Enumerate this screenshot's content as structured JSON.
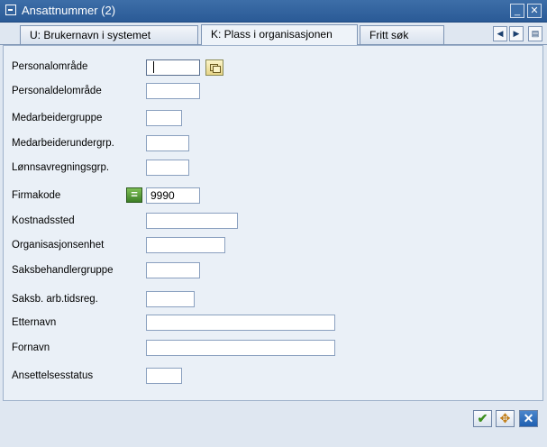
{
  "window": {
    "title": "Ansattnummer (2)"
  },
  "tabs": [
    {
      "label": "U: Brukernavn i systemet"
    },
    {
      "label": "K: Plass i organisasjonen"
    },
    {
      "label": "Fritt søk"
    }
  ],
  "form": {
    "fields": [
      {
        "label": "Personalområde",
        "value": ""
      },
      {
        "label": "Personaldelområde",
        "value": ""
      },
      {
        "label": "Medarbeidergruppe",
        "value": ""
      },
      {
        "label": "Medarbeiderundergrp.",
        "value": ""
      },
      {
        "label": "Lønnsavregningsgrp.",
        "value": ""
      },
      {
        "label": "Firmakode",
        "value": "9990"
      },
      {
        "label": "Kostnadssted",
        "value": ""
      },
      {
        "label": "Organisasjonsenhet",
        "value": ""
      },
      {
        "label": "Saksbehandlergruppe",
        "value": ""
      },
      {
        "label": "Saksb. arb.tidsreg.",
        "value": ""
      },
      {
        "label": "Etternavn",
        "value": ""
      },
      {
        "label": "Fornavn",
        "value": ""
      },
      {
        "label": "Ansettelsesstatus",
        "value": ""
      }
    ]
  },
  "colors": {
    "titlebar": "#2a5a96",
    "panel": "#eaf0f7",
    "accept": "#3d8f1e",
    "cancel": "#1f5fb0"
  }
}
